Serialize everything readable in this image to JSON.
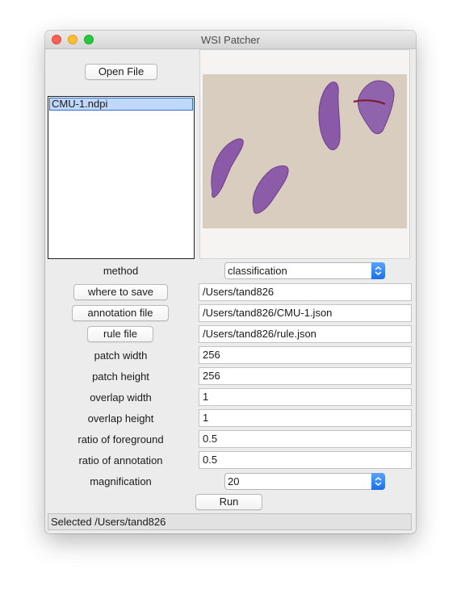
{
  "window": {
    "title": "WSI Patcher"
  },
  "buttons": {
    "open_file": "Open File",
    "where_to_save": "where to save",
    "annotation_file": "annotation file",
    "rule_file": "rule file",
    "run": "Run"
  },
  "file_list": {
    "items": [
      "CMU-1.ndpi"
    ],
    "selected": "CMU-1.ndpi"
  },
  "form": {
    "method_label": "method",
    "method_value": "classification",
    "save_path": "/Users/tand826",
    "annotation_path": "/Users/tand826/CMU-1.json",
    "rule_path": "/Users/tand826/rule.json",
    "patch_width_label": "patch width",
    "patch_width": "256",
    "patch_height_label": "patch height",
    "patch_height": "256",
    "overlap_width_label": "overlap width",
    "overlap_width": "1",
    "overlap_height_label": "overlap height",
    "overlap_height": "1",
    "ratio_foreground_label": "ratio of foreground",
    "ratio_foreground": "0.5",
    "ratio_annotation_label": "ratio of annotation",
    "ratio_annotation": "0.5",
    "magnification_label": "magnification",
    "magnification_value": "20"
  },
  "status": {
    "text": "Selected /Users/tand826"
  },
  "colors": {
    "selection": "#bfd8fb",
    "accent": "#1a6fe6",
    "tissue": "#8a5aa8"
  }
}
